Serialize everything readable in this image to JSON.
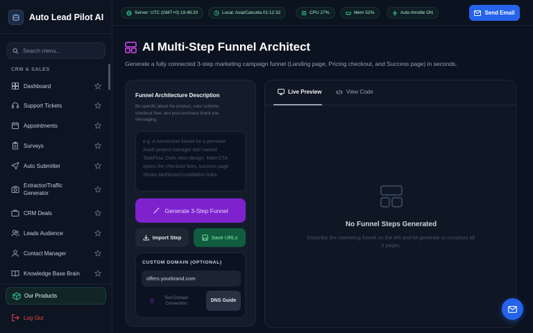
{
  "sidebar": {
    "brand_title": "Auto Lead Pilot AI",
    "search_placeholder": "Search menu...",
    "section_label": "CRM & SALES",
    "items": [
      {
        "label": "Dashboard",
        "icon": "dashboard-icon"
      },
      {
        "label": "Support Tickets",
        "icon": "headset-icon"
      },
      {
        "label": "Appointments",
        "icon": "calendar-icon"
      },
      {
        "label": "Surveys",
        "icon": "clipboard-icon"
      },
      {
        "label": "Auto Submitter",
        "icon": "send-icon"
      },
      {
        "label": "Extractor/Traffic Generator",
        "icon": "camera-icon"
      },
      {
        "label": "CRM Deals",
        "icon": "briefcase-icon"
      },
      {
        "label": "Leads Audience",
        "icon": "users-icon"
      },
      {
        "label": "Contact Manager",
        "icon": "contacts-icon"
      },
      {
        "label": "Knowledge Base Brain",
        "icon": "book-icon"
      }
    ],
    "products_label": "Our Products",
    "logout_label": "Log Out"
  },
  "topbar": {
    "server": "Server: UTC (GMT+0) 19:48:20",
    "local": "Local: Asia/Calcutta 01:12:32",
    "cpu": "CPU 27%",
    "mem": "Mem 52%",
    "throttle": "Auto-throttle ON",
    "send_email": "Send Email"
  },
  "main": {
    "title": "AI Multi-Step Funnel Architect",
    "subtitle": "Generate a fully connected 3-step marketing campaign funnel (Landing page, Pricing checkout, and Success page) in seconds."
  },
  "form": {
    "title": "Funnel Architecture Description",
    "help": "Be specific about the product, color scheme, checkout flow, and post-purchase thank you messaging.",
    "placeholder": "e.g. A conversion funnel for a premium SaaS project manager tool named TaskFlow. Dark neon design. Main CTA opens the checkout form, success page shows dashboard installation links.",
    "generate_label": "Generate 3-Step Funnel",
    "import_label": "Import Step",
    "save_label": "Save URLs",
    "domain_label": "CUSTOM DOMAIN (OPTIONAL)",
    "domain_value": "offers.yourbrand.com",
    "test_label": "Test Domain Connection",
    "dns_label": "DNS Guide"
  },
  "preview": {
    "tab_live": "Live Preview",
    "tab_code": "View Code",
    "empty_title": "No Funnel Steps Generated",
    "empty_desc": "Describe the marketing funnel on the left and hit generate to construct all 3 pages."
  },
  "colors": {
    "accent_blue": "#2563eb",
    "accent_purple": "#7e22ce",
    "accent_green": "#0f5c3f",
    "logout_red": "#ef4444",
    "title_icon": "#d946ef"
  }
}
